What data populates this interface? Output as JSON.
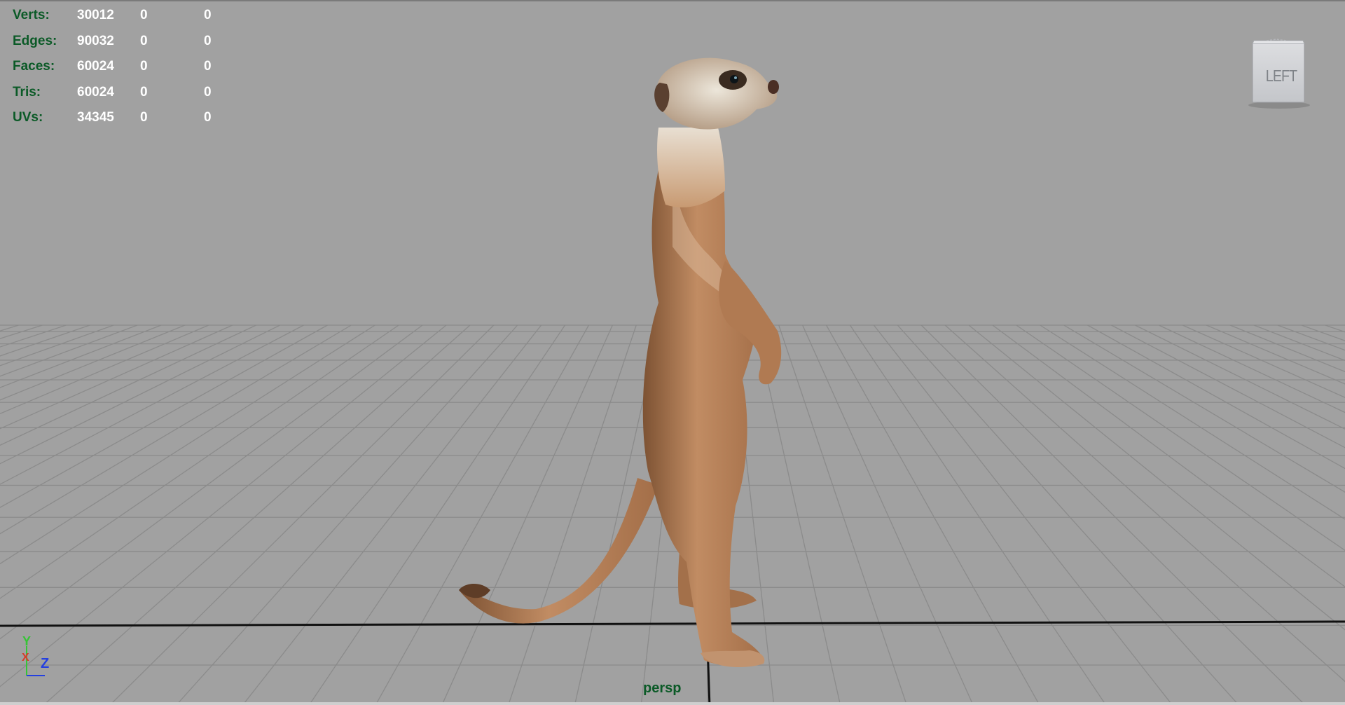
{
  "hud": {
    "rows": [
      {
        "label": "Verts:",
        "values": [
          "30012",
          "0",
          "0"
        ]
      },
      {
        "label": "Edges:",
        "values": [
          "90032",
          "0",
          "0"
        ]
      },
      {
        "label": "Faces:",
        "values": [
          "60024",
          "0",
          "0"
        ]
      },
      {
        "label": "Tris:",
        "values": [
          "60024",
          "0",
          "0"
        ]
      },
      {
        "label": "UVs:",
        "values": [
          "34345",
          "0",
          "0"
        ]
      }
    ]
  },
  "viewcube": {
    "face_label": "LEFT"
  },
  "axis_indicator": {
    "y": "Y",
    "x": "X",
    "z": "Z"
  },
  "camera": {
    "name": "persp"
  },
  "colors": {
    "background": "#a1a1a1",
    "grid_line": "#8a8a8a",
    "hud_label": "#0b5a27",
    "hud_value": "#ffffff",
    "axis_y": "#36c436",
    "axis_x": "#d83c2c",
    "axis_z": "#2440e0"
  },
  "icons": {
    "model": "meerkat-model",
    "viewcube": "view-cube-icon",
    "axis": "axis-gizmo-icon"
  }
}
